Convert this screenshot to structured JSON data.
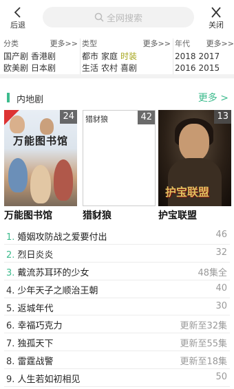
{
  "header": {
    "back_label": "后退",
    "close_label": "关闭",
    "search_placeholder": "全网搜索"
  },
  "filters": [
    {
      "title": "分类",
      "more": "更多>>",
      "rows": [
        [
          "国产剧",
          "香港剧"
        ],
        [
          "欧美剧",
          "日本剧"
        ]
      ]
    },
    {
      "title": "类型",
      "more": "更多>>",
      "rows": [
        [
          "都市",
          "家庭",
          "时装"
        ],
        [
          "生活",
          "农村",
          "喜剧"
        ]
      ],
      "highlight": "时装"
    },
    {
      "title": "年代",
      "more": "更多>>",
      "rows": [
        [
          "2018",
          "2017"
        ],
        [
          "2016",
          "2015"
        ]
      ]
    }
  ],
  "section": {
    "title": "内地剧",
    "more": "更多 >"
  },
  "cards": [
    {
      "title": "万能图书馆",
      "badge": "24",
      "poster_text": "万能图书馆"
    },
    {
      "title": "猎豺狼",
      "badge": "42",
      "poster_text": "猎豺狼"
    },
    {
      "title": "护宝联盟",
      "badge": "13",
      "poster_text": "护宝联盟"
    }
  ],
  "list": [
    {
      "num": "1.",
      "name": "婚姻攻防战之爱要付出",
      "info": "46"
    },
    {
      "num": "2.",
      "name": "烈日炎炎",
      "info": "32"
    },
    {
      "num": "3.",
      "name": "戴流苏耳环的少女",
      "info": "48集全"
    },
    {
      "num": "4.",
      "name": "少年天子之顺治王朝",
      "info": "40"
    },
    {
      "num": "5.",
      "name": "返城年代",
      "info": "30"
    },
    {
      "num": "6.",
      "name": "幸福巧克力",
      "info": "更新至32集"
    },
    {
      "num": "7.",
      "name": "独孤天下",
      "info": "更新至55集"
    },
    {
      "num": "8.",
      "name": "雷霆战警",
      "info": "更新至18集"
    },
    {
      "num": "9.",
      "name": "人生若如初相见",
      "info": "50"
    }
  ],
  "colors": {
    "accent": "#3dbb8d",
    "highlight": "#a4a41a"
  }
}
